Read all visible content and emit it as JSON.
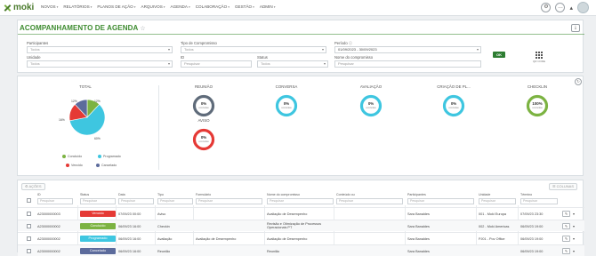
{
  "brand": {
    "name": "moki"
  },
  "nav": [
    {
      "label": "NOVOS"
    },
    {
      "label": "RELATÓRIOS"
    },
    {
      "label": "PLANOS DE AÇÃO"
    },
    {
      "label": "ARQUIVOS"
    },
    {
      "label": "AGENDA"
    },
    {
      "label": "COLABORAÇÃO"
    },
    {
      "label": "GESTÃO"
    },
    {
      "label": "ADMIN"
    }
  ],
  "page": {
    "title": "ACOMPANHAMENTO DE AGENDA",
    "favorite_icon": "star-outline-icon"
  },
  "filters": {
    "participantes": {
      "label": "Participantes",
      "placeholder": "Todos"
    },
    "tipo": {
      "label": "Tipo de Compromisso",
      "placeholder": "Todos"
    },
    "periodo": {
      "label": "Período",
      "value": "01/09/2023 - 30/09/2023"
    },
    "unidade": {
      "label": "Unidade",
      "placeholder": "Todos"
    },
    "id": {
      "label": "ID",
      "placeholder": "Pesquisar"
    },
    "status": {
      "label": "Status",
      "placeholder": "Todos"
    },
    "nome": {
      "label": "Nome do compromisso",
      "placeholder": "Pesquisar"
    },
    "ok_label": "OK",
    "qr_label": "QR CODE"
  },
  "dashboard": {
    "total": {
      "title": "TOTAL",
      "slices": [
        {
          "label": "Concluído",
          "pct": 12,
          "color": "#7cb342"
        },
        {
          "label": "Programado",
          "pct": 60,
          "color": "#3ec6e0"
        },
        {
          "label": "Vencido",
          "pct": 16,
          "color": "#e53935"
        },
        {
          "label": "Cancelado",
          "pct": 12,
          "color": "#5c6b9c"
        }
      ],
      "slice_labels": [
        "12%",
        "60%",
        "16%",
        "12%"
      ]
    },
    "donuts": [
      {
        "title": "REUNIÃO",
        "pct": "0%",
        "sub": "concluídas",
        "color": "#5f6b7a",
        "fill": 0
      },
      {
        "title": "CONVERSA",
        "pct": "0%",
        "sub": "concluídas",
        "color": "#3ec6e0",
        "fill": 0
      },
      {
        "title": "AVALIAÇÃO",
        "pct": "0%",
        "sub": "concluídas",
        "color": "#3ec6e0",
        "fill": 0
      },
      {
        "title": "CRIAÇÃO DE PL...",
        "pct": "0%",
        "sub": "concluídas",
        "color": "#3ec6e0",
        "fill": 0
      },
      {
        "title": "CHECKLIN",
        "pct": "100%",
        "sub": "concluídas",
        "color": "#7cb342",
        "fill": 1
      },
      {
        "title": "AVISO",
        "pct": "0%",
        "sub": "concluídas",
        "color": "#e53935",
        "fill": 0
      }
    ]
  },
  "table": {
    "actions_label": "AÇÕES",
    "columns_label": "COLUNAS",
    "headers": [
      "ID",
      "Status",
      "Data",
      "Tipo",
      "Formulário",
      "Nome do compromisso",
      "Conteúdo ou",
      "Participantes",
      "Unidade",
      "Término"
    ],
    "filter_placeholder": "Pesquisar",
    "status_filter_placeholder": "Pesquisar",
    "rows": [
      {
        "id": "A23000000003",
        "status": "Vencido",
        "status_color": "#e53935",
        "data": "07/09/23 00:00",
        "tipo": "Aviso",
        "form": "",
        "nome": "Avaliação de Desempenho",
        "conteudo": "",
        "part": "Sara Banaldes",
        "unidade": "001 - Moki Europa",
        "termino": "07/09/23 23:30"
      },
      {
        "id": "A23000000002",
        "status": "Concluído",
        "status_color": "#7cb342",
        "data": "06/09/23 16:00",
        "tipo": "Checkin",
        "form": "",
        "nome": "Revisão e Otimização de Processos Operacionais PT",
        "conteudo": "",
        "part": "Sara Banaldes",
        "unidade": "002 - Moki Americas",
        "termino": "06/09/23 19:00"
      },
      {
        "id": "A23000000002",
        "status": "Programado",
        "status_color": "#3ec6e0",
        "data": "06/09/23 16:00",
        "tipo": "Avaliação",
        "form": "Avaliação de Desempenho",
        "nome": "Avaliação de Desempenho",
        "conteudo": "",
        "part": "Sara Banaldes",
        "unidade": "PJ01 - Pov Office",
        "termino": "06/09/23 19:00"
      },
      {
        "id": "A23000000002",
        "status": "Cancelado",
        "status_color": "#5c6b9c",
        "data": "06/09/23 16:00",
        "tipo": "Reunião",
        "form": "",
        "nome": "Reunião",
        "conteudo": "",
        "part": "Sara Banaldes",
        "unidade": "",
        "termino": "06/09/23 19:00"
      }
    ]
  }
}
